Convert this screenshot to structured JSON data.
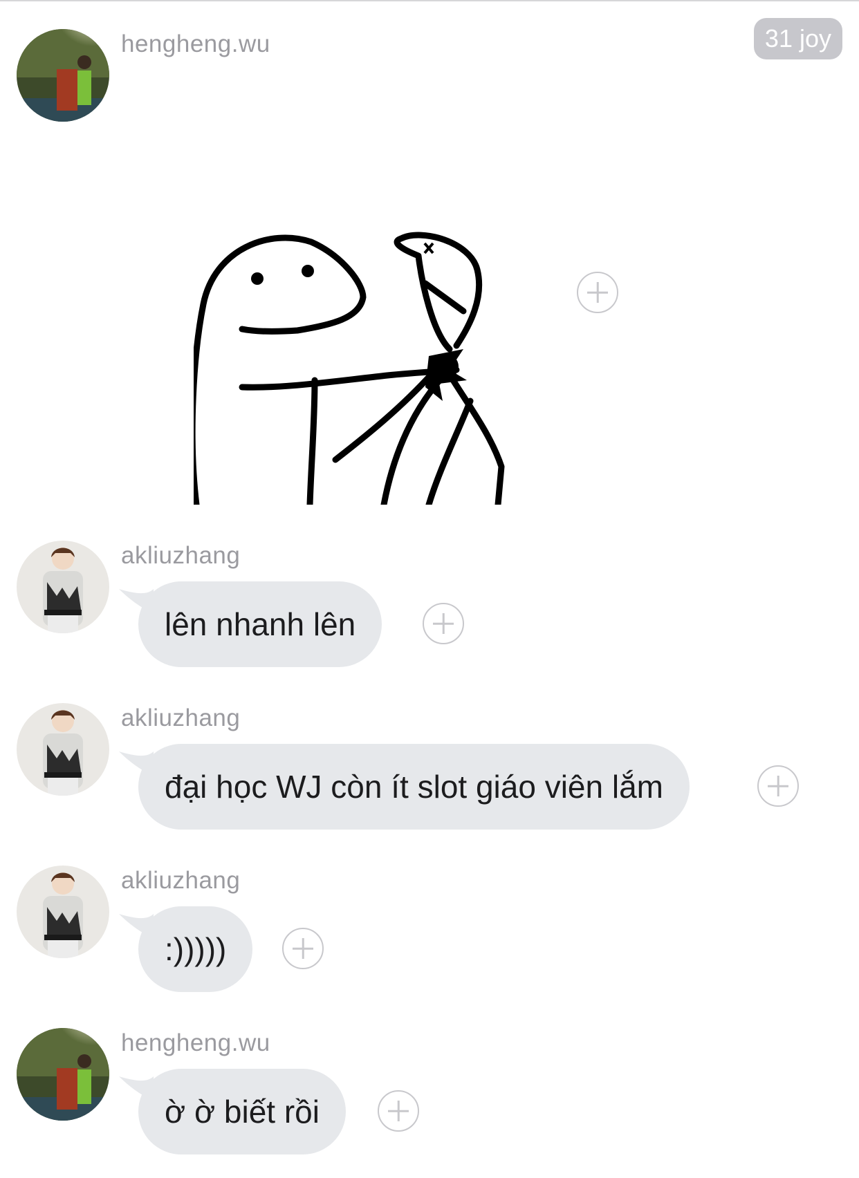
{
  "timestamp": "31 joy",
  "users": {
    "heng": "hengheng.wu",
    "liu": "akliuzhang"
  },
  "messages": [
    {
      "sender": "hengheng.wu",
      "type": "sticker",
      "sticker": "stick-figure-holding-hanged-figure"
    },
    {
      "sender": "akliuzhang",
      "type": "text",
      "text": "lên nhanh lên"
    },
    {
      "sender": "akliuzhang",
      "type": "text",
      "text": "đại học WJ còn ít slot giáo viên lắm"
    },
    {
      "sender": "akliuzhang",
      "type": "text",
      "text": ":)))))"
    },
    {
      "sender": "hengheng.wu",
      "type": "text",
      "text": "ờ ờ biết rồi"
    }
  ],
  "colors": {
    "bubble": "#e6e8eb",
    "username": "#9a9a9f",
    "timestamp_bg": "#c7c7cc",
    "plus_ring": "#c8c8cc"
  },
  "icons": {
    "react": "plus-circle-icon"
  }
}
